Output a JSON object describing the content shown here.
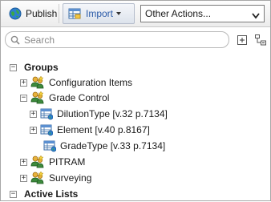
{
  "toolbar": {
    "publish_label": "Publish",
    "import_label": "Import",
    "other_actions_value": "Other Actions..."
  },
  "search": {
    "placeholder": "Search"
  },
  "tree": {
    "groups_label": "Groups",
    "configuration_items_label": "Configuration Items",
    "grade_control_label": "Grade Control",
    "dilution_type_label": "DilutionType [v.32 p.7134]",
    "element_label": "Element [v.40 p.8167]",
    "grade_type_label": "GradeType [v.33 p.7134]",
    "pitram_label": "PITRAM",
    "surveying_label": "Surveying",
    "active_lists_label": "Active Lists"
  },
  "colors": {
    "accent": "#2a5aa8",
    "border": "#a7a7a7"
  }
}
